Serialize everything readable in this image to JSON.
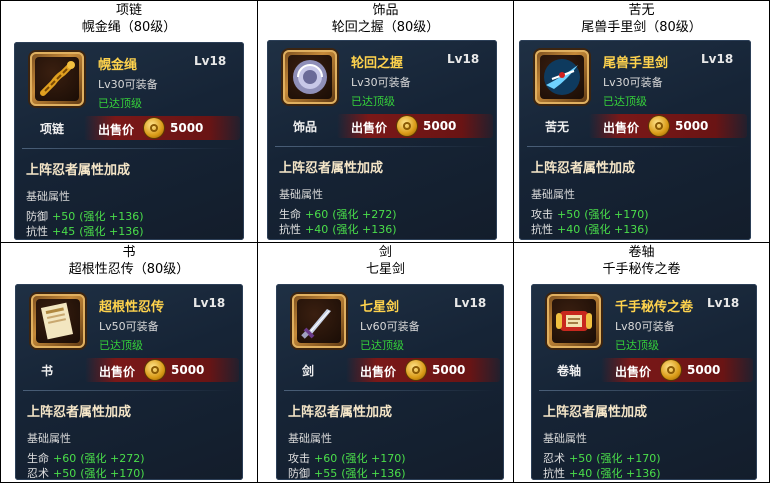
{
  "cells": [
    {
      "category": "项链",
      "item_title": "幌金绳（80级）",
      "name": "幌金绳",
      "level": "Lv18",
      "requirement": "Lv30可装备",
      "status": "已达顶级",
      "type_label": "项链",
      "price_label": "出售价",
      "price": "5000",
      "section": "上阵忍者属性加成",
      "base_label": "基础属性",
      "icon": "rope-icon",
      "stats": [
        {
          "label": "防御",
          "value": "+50",
          "enhance": "(强化 +136)"
        },
        {
          "label": "抗性",
          "value": "+45",
          "enhance": "(强化 +136)"
        }
      ]
    },
    {
      "category": "饰品",
      "item_title": "轮回之握（80级）",
      "name": "轮回之握",
      "level": "Lv18",
      "requirement": "Lv30可装备",
      "status": "已达顶级",
      "type_label": "饰品",
      "price_label": "出售价",
      "price": "5000",
      "section": "上阵忍者属性加成",
      "base_label": "基础属性",
      "icon": "orb-icon",
      "stats": [
        {
          "label": "生命",
          "value": "+60",
          "enhance": "(强化 +272)"
        },
        {
          "label": "抗性",
          "value": "+40",
          "enhance": "(强化 +136)"
        }
      ]
    },
    {
      "category": "苦无",
      "item_title": "尾兽手里剑（80级）",
      "name": "尾兽手里剑",
      "level": "Lv18",
      "requirement": "Lv30可装备",
      "status": "已达顶级",
      "type_label": "苦无",
      "price_label": "出售价",
      "price": "5000",
      "section": "上阵忍者属性加成",
      "base_label": "基础属性",
      "icon": "shuriken-icon",
      "stats": [
        {
          "label": "攻击",
          "value": "+50",
          "enhance": "(强化 +170)"
        },
        {
          "label": "抗性",
          "value": "+40",
          "enhance": "(强化 +136)"
        }
      ]
    },
    {
      "category": "书",
      "item_title": "超根性忍传（80级）",
      "name": "超根性忍传",
      "level": "Lv18",
      "requirement": "Lv50可装备",
      "status": "已达顶级",
      "type_label": "书",
      "price_label": "出售价",
      "price": "5000",
      "section": "上阵忍者属性加成",
      "base_label": "基础属性",
      "icon": "book-icon",
      "stats": [
        {
          "label": "生命",
          "value": "+60",
          "enhance": "(强化 +272)"
        },
        {
          "label": "忍术",
          "value": "+50",
          "enhance": "(强化 +170)"
        }
      ]
    },
    {
      "category": "剑",
      "item_title": "七星剑",
      "name": "七星剑",
      "level": "Lv18",
      "requirement": "Lv60可装备",
      "status": "已达顶级",
      "type_label": "剑",
      "price_label": "出售价",
      "price": "5000",
      "section": "上阵忍者属性加成",
      "base_label": "基础属性",
      "icon": "sword-icon",
      "stats": [
        {
          "label": "攻击",
          "value": "+60",
          "enhance": "(强化 +170)"
        },
        {
          "label": "防御",
          "value": "+55",
          "enhance": "(强化 +136)"
        }
      ]
    },
    {
      "category": "卷轴",
      "item_title": "千手秘传之卷",
      "name": "千手秘传之卷",
      "level": "Lv18",
      "requirement": "Lv80可装备",
      "status": "已达顶级",
      "type_label": "卷轴",
      "price_label": "出售价",
      "price": "5000",
      "section": "上阵忍者属性加成",
      "base_label": "基础属性",
      "icon": "scroll-icon",
      "stats": [
        {
          "label": "忍术",
          "value": "+50",
          "enhance": "(强化 +170)"
        },
        {
          "label": "抗性",
          "value": "+40",
          "enhance": "(强化 +136)"
        }
      ]
    }
  ]
}
